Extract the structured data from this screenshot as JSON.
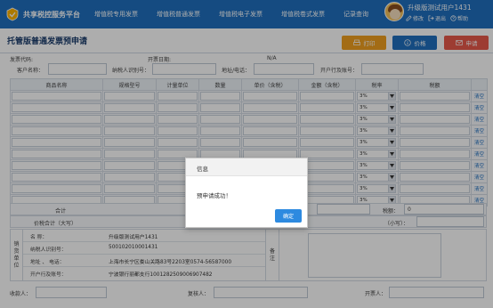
{
  "brand": {
    "name": "共享税控服务平台"
  },
  "nav": [
    "增值税专用发票",
    "增值税普通发票",
    "增值税电子发票",
    "增值税卷式发票",
    "记录查询"
  ],
  "user": {
    "name": "升级版测试用户1431",
    "actions": [
      "修改",
      "退出",
      "帮助"
    ]
  },
  "page": {
    "title": "托管版普通发票预申请"
  },
  "toolbar": {
    "print": "打印",
    "price": "价格",
    "apply": "申请"
  },
  "header": {
    "invoice_code_label": "发票代码:",
    "issue_date_label": "开票日期:",
    "issue_date_value": "N/A",
    "customer_label": "客户名称：",
    "taxid_label": "纳税人识别号：",
    "addr_label": "地址/电话：",
    "bank_label": "开户行及账号："
  },
  "table": {
    "columns": [
      "商品名称",
      "规格型号",
      "计量单位",
      "数量",
      "单价（含税）",
      "金额（含税）",
      "税率",
      "税额",
      ""
    ],
    "rows": [
      {
        "rate": "3%",
        "clear": "清空"
      },
      {
        "rate": "3%",
        "clear": "清空"
      },
      {
        "rate": "3%",
        "clear": "清空"
      },
      {
        "rate": "3%",
        "clear": "清空"
      },
      {
        "rate": "3%",
        "clear": "清空"
      },
      {
        "rate": "3%",
        "clear": "清空"
      },
      {
        "rate": "3%",
        "clear": "清空"
      },
      {
        "rate": "3%",
        "clear": "清空"
      },
      {
        "rate": "3%",
        "clear": "清空"
      },
      {
        "rate": "3%",
        "clear": "清空"
      }
    ]
  },
  "totals": {
    "total_label": "合计",
    "tax_label": "税额：",
    "tax_value": "0",
    "amount_caps_label": "价税合计（大写）",
    "small_label": "（小写）："
  },
  "seller": {
    "side_label": [
      "销",
      "货",
      "单",
      "位"
    ],
    "rows": [
      {
        "key": "名      称：",
        "value": "升级版测试用户1431"
      },
      {
        "key": "纳税人识别号：",
        "value": "500102010001431"
      },
      {
        "key": "地址 、 电话：",
        "value": "上海市长宁区娄山关路83号2203室0574-56587000"
      },
      {
        "key": "开户行及账号：",
        "value": "宁波银行丽都支行1001282509006907482"
      }
    ],
    "note_label": [
      "备",
      "注"
    ]
  },
  "footer": {
    "payee": "收款人：",
    "reviewer": "复核人：",
    "drawer": "开票人："
  },
  "modal": {
    "title": "信息",
    "message": "预申请成功！",
    "ok": "确定"
  }
}
